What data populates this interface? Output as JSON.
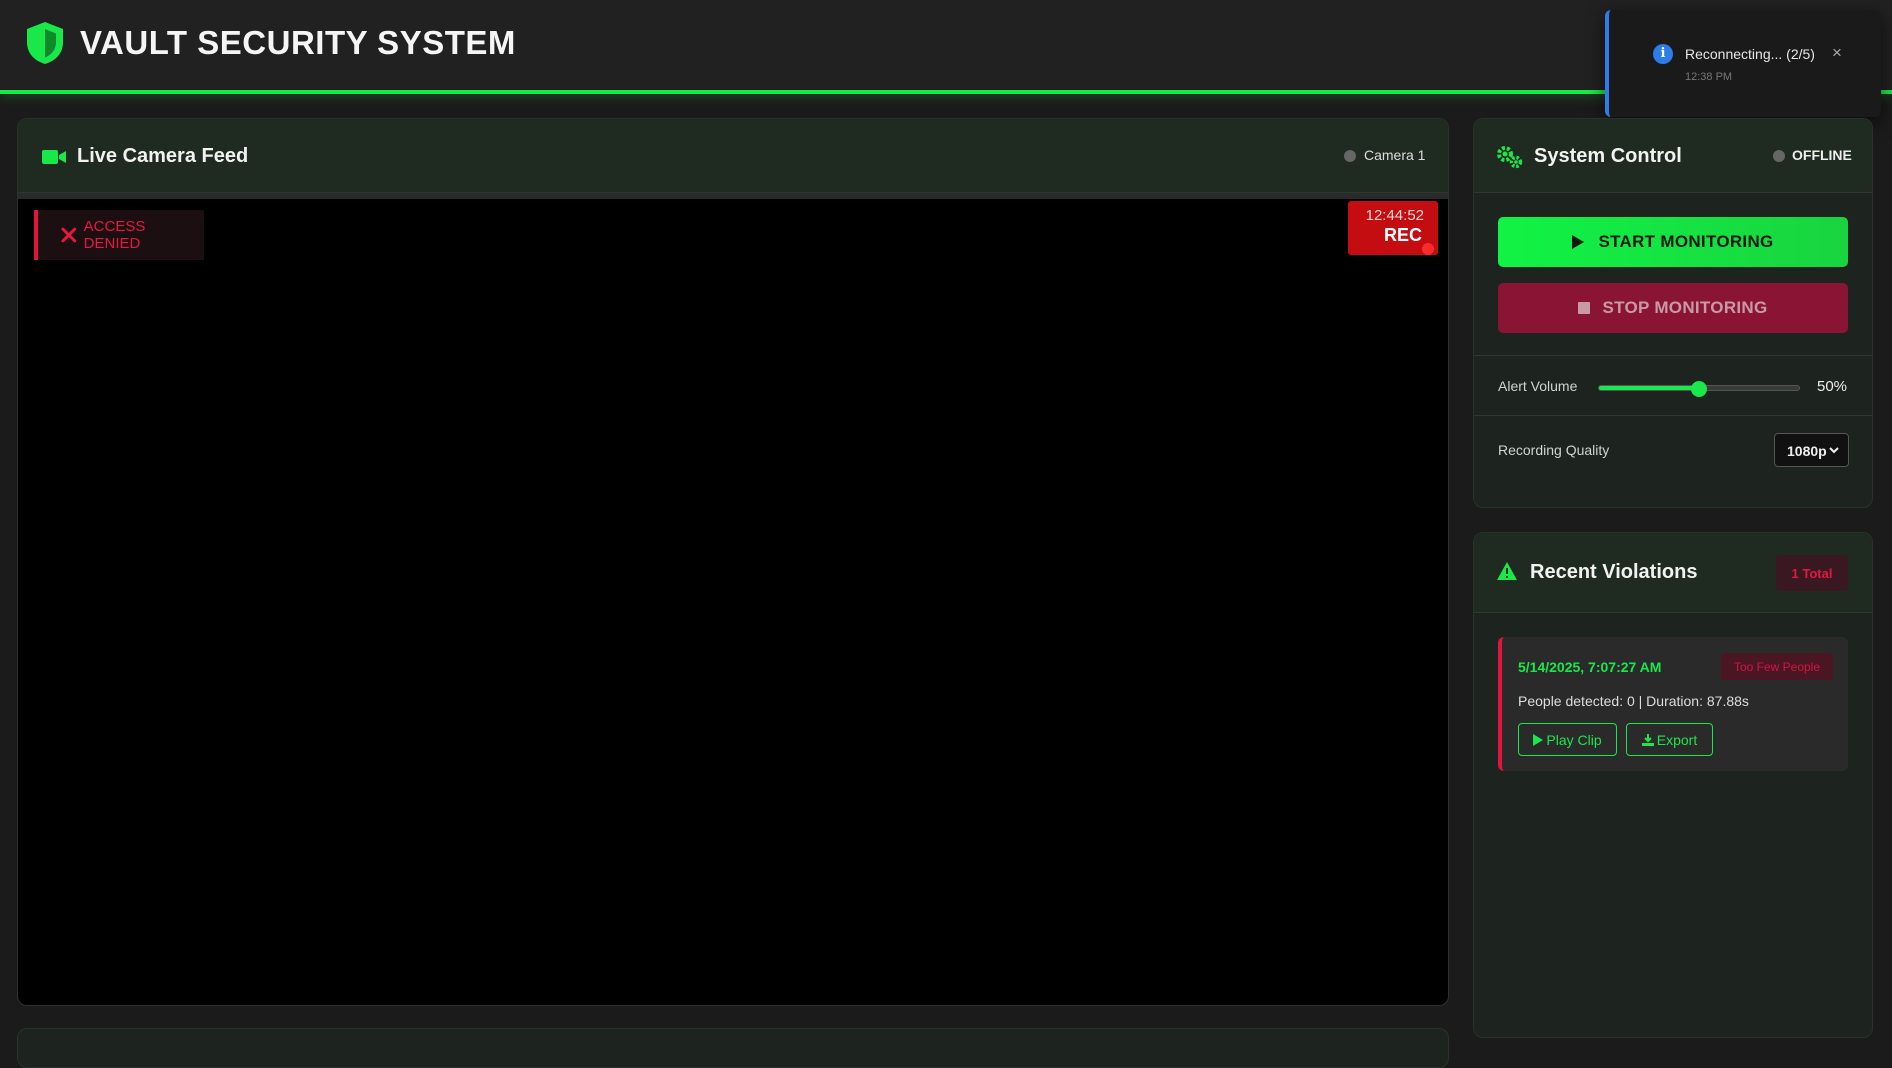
{
  "header": {
    "title": "VAULT SECURITY SYSTEM",
    "icon": "shield-icon"
  },
  "toast": {
    "message": "Reconnecting... (2/5)",
    "time": "12:38 PM",
    "close": "×",
    "icon": "info-icon"
  },
  "camera": {
    "title": "Live Camera Feed",
    "camera_label": "Camera 1",
    "access_text": "ACCESS DENIED",
    "rec_time": "12:44:52",
    "rec_label": "REC"
  },
  "control": {
    "title": "System Control",
    "status": "OFFLINE",
    "start_label": "START MONITORING",
    "stop_label": "STOP MONITORING",
    "volume_label": "Alert Volume",
    "volume_value": 50,
    "volume_text": "50%",
    "quality_label": "Recording Quality",
    "quality_value": "1080p"
  },
  "violations": {
    "title": "Recent Violations",
    "total": "1 Total",
    "items": [
      {
        "timestamp": "5/14/2025, 7:07:27 AM",
        "type": "Too Few People",
        "details": "People detected: 0 | Duration: 87.88s",
        "play_label": "Play Clip",
        "export_label": "Export"
      }
    ]
  },
  "colors": {
    "accent": "#19e84a",
    "danger": "#e0143c",
    "info": "#2b7de9",
    "background": "#1b1b1b"
  }
}
